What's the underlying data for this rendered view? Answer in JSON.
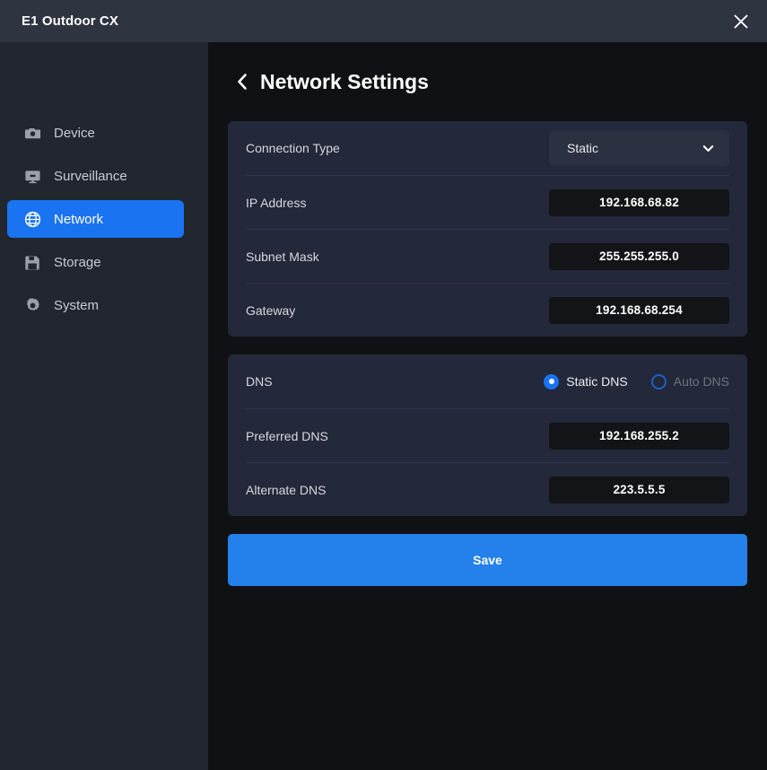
{
  "window": {
    "title": "E1 Outdoor CX",
    "close_icon": "close-icon",
    "titlebar_color": "#2e3440"
  },
  "theme": {
    "accent": "#1a73f0",
    "save_button": "#2481ec",
    "card_bg": "#23283a",
    "sidebar_bg": "#22262f",
    "main_bg": "#101114",
    "input_bg": "#131417",
    "disabled_text": "#6f7480"
  },
  "sidebar": {
    "items": [
      {
        "label": "Device",
        "icon": "camera-icon",
        "active": false
      },
      {
        "label": "Surveillance",
        "icon": "monitor-icon",
        "active": false
      },
      {
        "label": "Network",
        "icon": "globe-icon",
        "active": true
      },
      {
        "label": "Storage",
        "icon": "floppy-disk-icon",
        "active": false
      },
      {
        "label": "System",
        "icon": "gear-icon",
        "active": false
      }
    ]
  },
  "page": {
    "back_icon": "chevron-left-icon",
    "title": "Network Settings"
  },
  "network_card": {
    "connection_type": {
      "label": "Connection Type",
      "value": "Static",
      "options": [
        "Static"
      ],
      "chevron_icon": "chevron-down-icon"
    },
    "ip_address": {
      "label": "IP Address",
      "value": "192.168.68.82",
      "placeholder": "IP Address"
    },
    "subnet_mask": {
      "label": "Subnet Mask",
      "value": "255.255.255.0",
      "placeholder": "Subnet Mask"
    },
    "gateway": {
      "label": "Gateway",
      "value": "192.168.68.254",
      "placeholder": "Gateway"
    }
  },
  "dns_card": {
    "dns": {
      "label": "DNS",
      "options": [
        {
          "label": "Static DNS",
          "selected": true
        },
        {
          "label": "Auto DNS",
          "selected": false
        }
      ]
    },
    "preferred_dns": {
      "label": "Preferred DNS",
      "value": "192.168.255.2",
      "placeholder": "Preferred DNS"
    },
    "alternate_dns": {
      "label": "Alternate DNS",
      "value": "223.5.5.5",
      "placeholder": "Alternate DNS"
    }
  },
  "actions": {
    "save_label": "Save"
  }
}
